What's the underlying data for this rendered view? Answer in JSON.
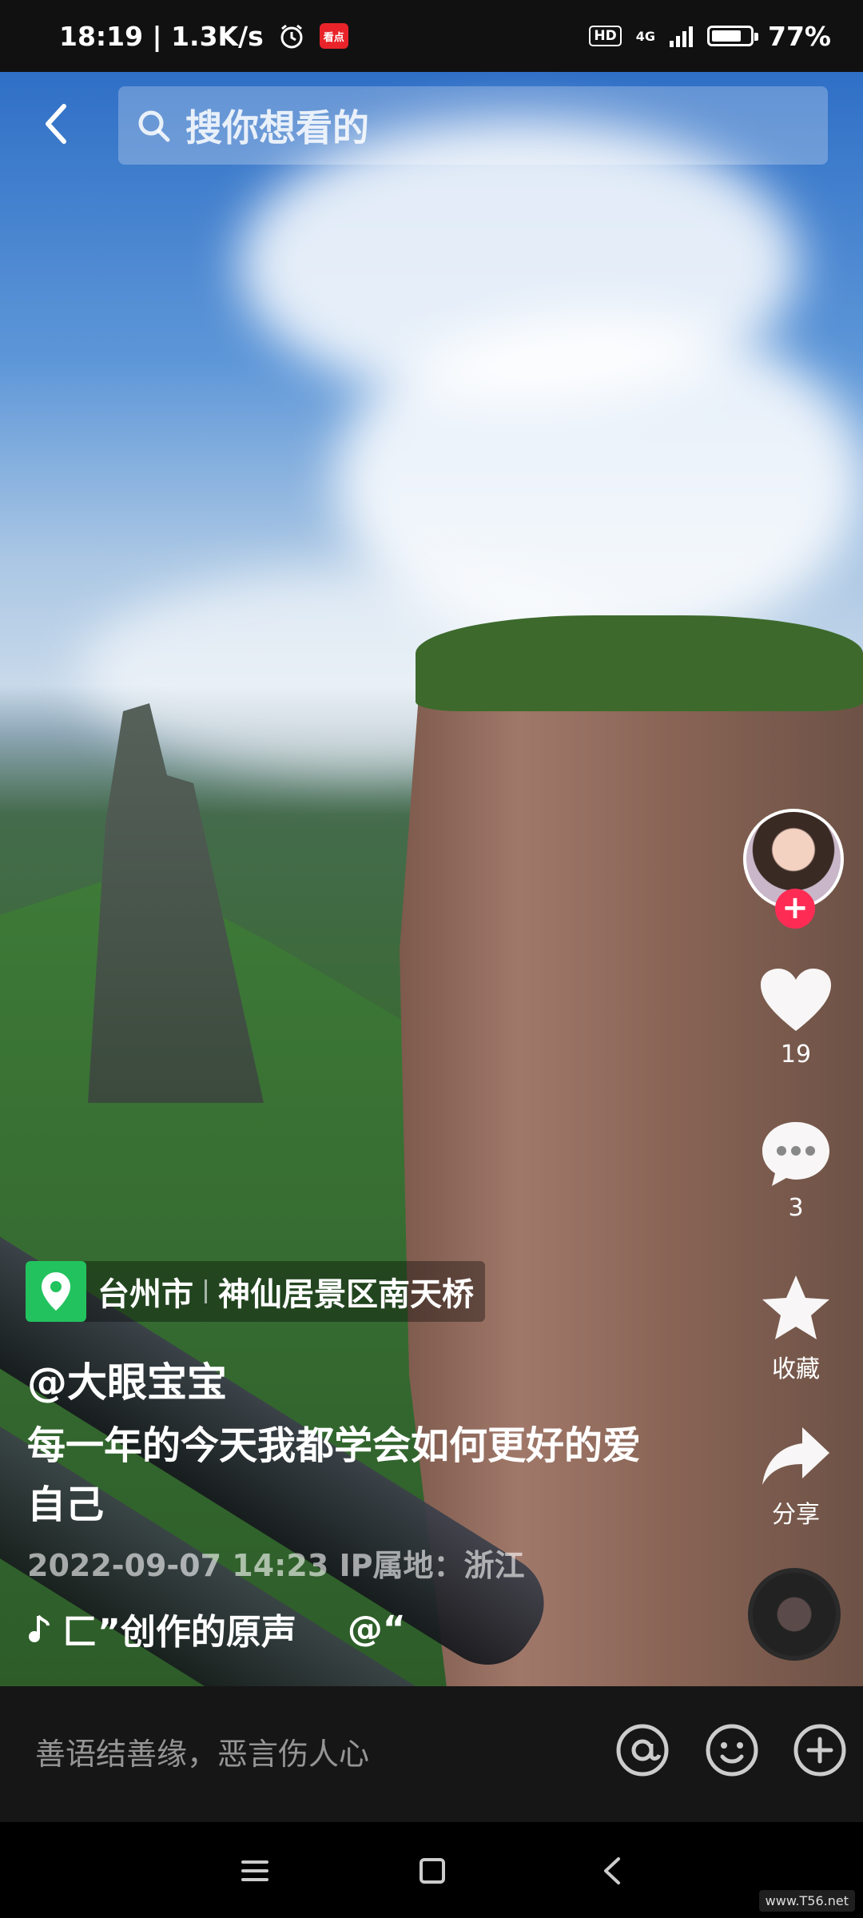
{
  "status_bar": {
    "time_speed": "18:19 | 1.3K/s",
    "app_badge": "看点",
    "hd": "HD",
    "network": "4G",
    "battery": "77%",
    "battery_level": 0.77,
    "icons": [
      "alarm-icon",
      "signal-icon",
      "battery-icon"
    ]
  },
  "top_bar": {
    "back_icon": "chevron-left-icon",
    "search_icon": "search-icon",
    "search_placeholder": "搜你想看的"
  },
  "right_rail": {
    "follow_label": "+",
    "like_count": "19",
    "comment_count": "3",
    "favorite_label": "收藏",
    "share_label": "分享"
  },
  "caption": {
    "location_city": "台州市",
    "location_place": "神仙居景区南天桥",
    "author": "@大眼宝宝",
    "description": "每一年的今天我都学会如何更好的爱自己",
    "meta": "2022-09-07 14:23  IP属地：浙江",
    "music_text": "匚”创作的原声",
    "music_mention": "@“",
    "music_icon": "music-note-icon"
  },
  "comment_bar": {
    "placeholder": "善语结善缘，恶言伤人心",
    "icons": [
      "at-icon",
      "emoji-icon",
      "plus-circle-icon"
    ]
  },
  "nav_bar": {
    "icons": [
      "menu-icon",
      "home-square-icon",
      "back-triangle-icon"
    ]
  },
  "watermark": "www.T56.net"
}
